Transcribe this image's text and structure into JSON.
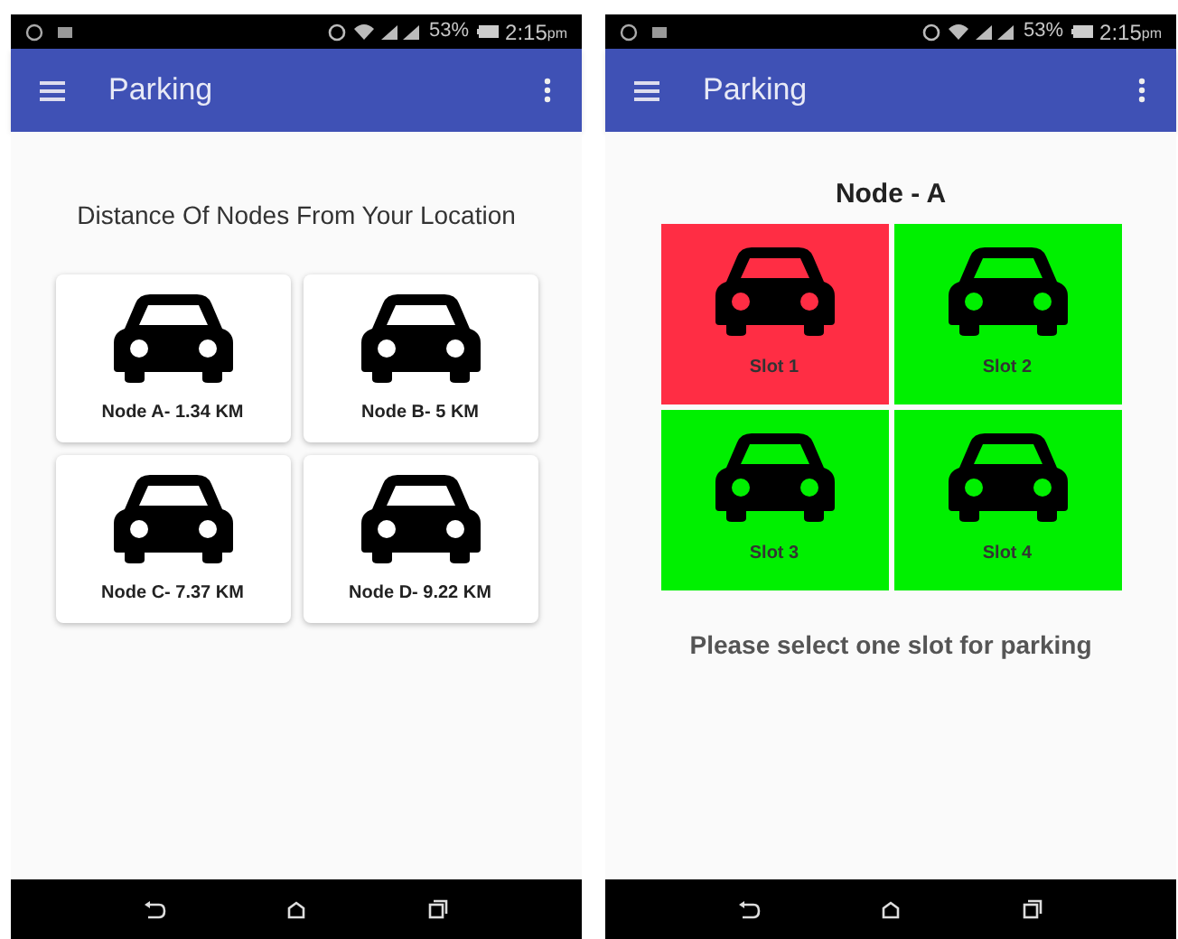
{
  "screens": [
    {
      "status_bar": {
        "battery": "53%",
        "time": "2:15",
        "ampm": "pm"
      },
      "app_bar": {
        "title": "Parking"
      },
      "kind": "nodes",
      "heading": "Distance Of Nodes From Your Location",
      "nodes": [
        {
          "label": "Node A- 1.34 KM"
        },
        {
          "label": "Node B- 5 KM"
        },
        {
          "label": "Node C- 7.37 KM"
        },
        {
          "label": "Node D- 9.22 KM"
        }
      ]
    },
    {
      "status_bar": {
        "battery": "53%",
        "time": "2:15",
        "ampm": "pm"
      },
      "app_bar": {
        "title": "Parking"
      },
      "kind": "slots",
      "heading": "Node - A",
      "slots": [
        {
          "label": "Slot 1",
          "color": "#ff2d44"
        },
        {
          "label": "Slot 2",
          "color": "#00f000"
        },
        {
          "label": "Slot 3",
          "color": "#00f000"
        },
        {
          "label": "Slot 4",
          "color": "#00f000"
        }
      ],
      "message": "Please select one slot for parking"
    }
  ]
}
